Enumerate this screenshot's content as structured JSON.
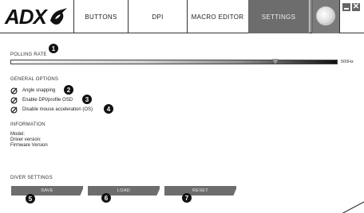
{
  "brand": {
    "logo_text": "ADX"
  },
  "tabs": [
    {
      "label": "BUTTONS"
    },
    {
      "label": "DPI"
    },
    {
      "label": "MACRO EDITOR"
    },
    {
      "label": "SETTINGS"
    }
  ],
  "window": {
    "close_glyph": "✕"
  },
  "polling": {
    "label": "POLLING RATE",
    "value_text": "500Hz",
    "slider_level": 0.81
  },
  "general": {
    "label": "GENERAL OPTIONS",
    "options": [
      {
        "label": "Angle snapping"
      },
      {
        "label": "Enable DPI/profile OSD"
      },
      {
        "label": "Disable mouse acceleration (OS)"
      }
    ]
  },
  "information": {
    "label": "INFORMATION",
    "lines": [
      "Model:",
      "Driver version:",
      "Firmware Version"
    ]
  },
  "driver": {
    "label": "DIVER SETTINGS",
    "buttons": [
      {
        "label": "SAVE"
      },
      {
        "label": "LOAD"
      },
      {
        "label": "RESET"
      }
    ]
  },
  "badges": [
    "1",
    "2",
    "3",
    "4",
    "5",
    "6",
    "7"
  ],
  "icons": {
    "logo_mark": "adx-logo-mark-icon",
    "check": "check-circle-icon",
    "profile": "profile-disc-icon"
  },
  "colors": {
    "active_tab": "#6d6d6d",
    "button": "#6d6d6d",
    "badge": "#111111"
  }
}
